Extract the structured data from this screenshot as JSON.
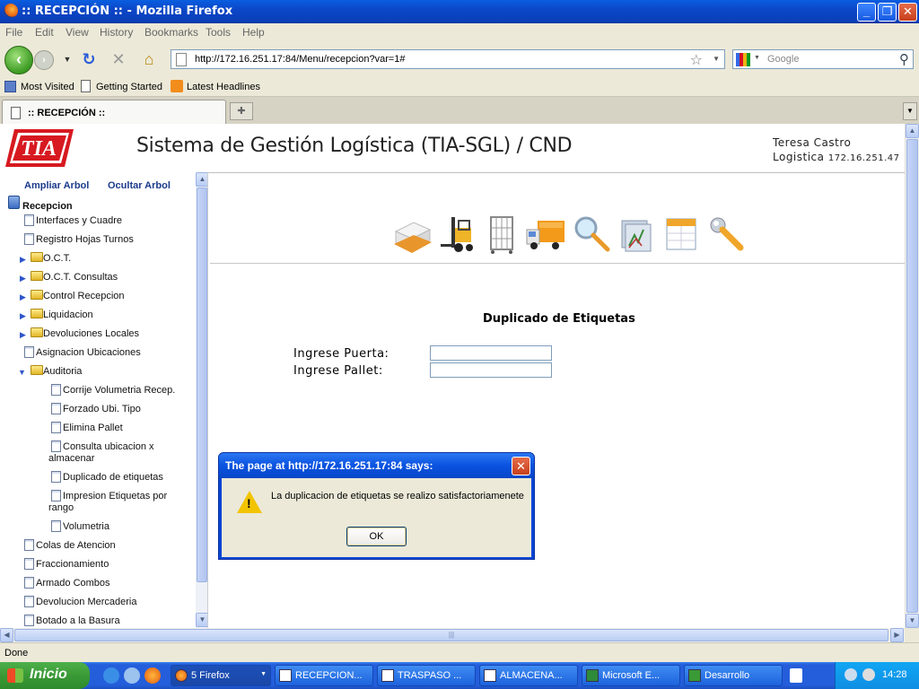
{
  "window": {
    "title": ":: RECEPCIÓN :: - Mozilla Firefox"
  },
  "menu": [
    "File",
    "Edit",
    "View",
    "History",
    "Bookmarks",
    "Tools",
    "Help"
  ],
  "url": "http://172.16.251.17:84/Menu/recepcion?var=1#",
  "search_placeholder": "Google",
  "bookmarks": [
    "Most Visited",
    "Getting Started",
    "Latest Headlines"
  ],
  "tab": {
    "label": ":: RECEPCIÓN ::"
  },
  "header": {
    "logo_text": "TIA",
    "title": "Sistema de Gestión Logística (TIA-SGL) / CND",
    "user_name": "Teresa Castro",
    "user_role": "Logistica",
    "user_ip": "172.16.251.47"
  },
  "tree": {
    "expand_label": "Ampliar Arbol",
    "hide_label": "Ocultar Arbol",
    "root": "Recepcion",
    "items": [
      {
        "label": "Interfaces y Cuadre",
        "type": "doc"
      },
      {
        "label": "Registro Hojas Turnos",
        "type": "doc"
      },
      {
        "label": "O.C.T.",
        "type": "folder"
      },
      {
        "label": "O.C.T. Consultas",
        "type": "folder"
      },
      {
        "label": "Control Recepcion",
        "type": "folder"
      },
      {
        "label": "Liquidacion",
        "type": "folder"
      },
      {
        "label": "Devoluciones Locales",
        "type": "folder"
      },
      {
        "label": "Asignacion Ubicaciones",
        "type": "doc"
      },
      {
        "label": "Auditoria",
        "type": "folder-open"
      },
      {
        "label": "Corrije Volumetria Recep.",
        "type": "child"
      },
      {
        "label": "Forzado Ubi. Tipo",
        "type": "child"
      },
      {
        "label": "Elimina Pallet",
        "type": "child"
      },
      {
        "label": "Consulta ubicacion x",
        "label2": "almacenar",
        "type": "child2"
      },
      {
        "label": "Duplicado de etiquetas",
        "type": "child"
      },
      {
        "label": "Impresion Etiquetas por",
        "label2": "rango",
        "type": "child2"
      },
      {
        "label": "Volumetria",
        "type": "child"
      },
      {
        "label": "Colas de Atencion",
        "type": "doc"
      },
      {
        "label": "Fraccionamiento",
        "type": "doc"
      },
      {
        "label": "Armado Combos",
        "type": "doc"
      },
      {
        "label": "Devolucion Mercaderia",
        "type": "doc"
      },
      {
        "label": "Botado a la Basura",
        "type": "doc"
      }
    ]
  },
  "toolbar_icons": [
    "pallet-icon",
    "forklift-icon",
    "cart-icon",
    "truck-icon",
    "magnifier-icon",
    "folders-icon",
    "calendar-icon",
    "wrench-icon"
  ],
  "form": {
    "title": "Duplicado de Etiquetas",
    "door_label": "Ingrese Puerta:",
    "door_value": "",
    "pallet_label": "Ingrese Pallet:",
    "pallet_value": ""
  },
  "dialog": {
    "title": "The page at http://172.16.251.17:84 says:",
    "message": "La duplicacion de etiquetas se realizo satisfactoriamenete",
    "ok_label": "OK"
  },
  "status": "Done",
  "taskbar": {
    "start_label": "Inicio",
    "items": [
      "5 Firefox",
      "RECEPCION...",
      "TRASPASO ...",
      "ALMACENA...",
      "Microsoft E...",
      "Desarrollo"
    ],
    "clock": "14:28"
  },
  "colors": {
    "brand_red": "#d71920",
    "link_blue": "#1c3a8c",
    "xp_blue": "#245edb"
  }
}
